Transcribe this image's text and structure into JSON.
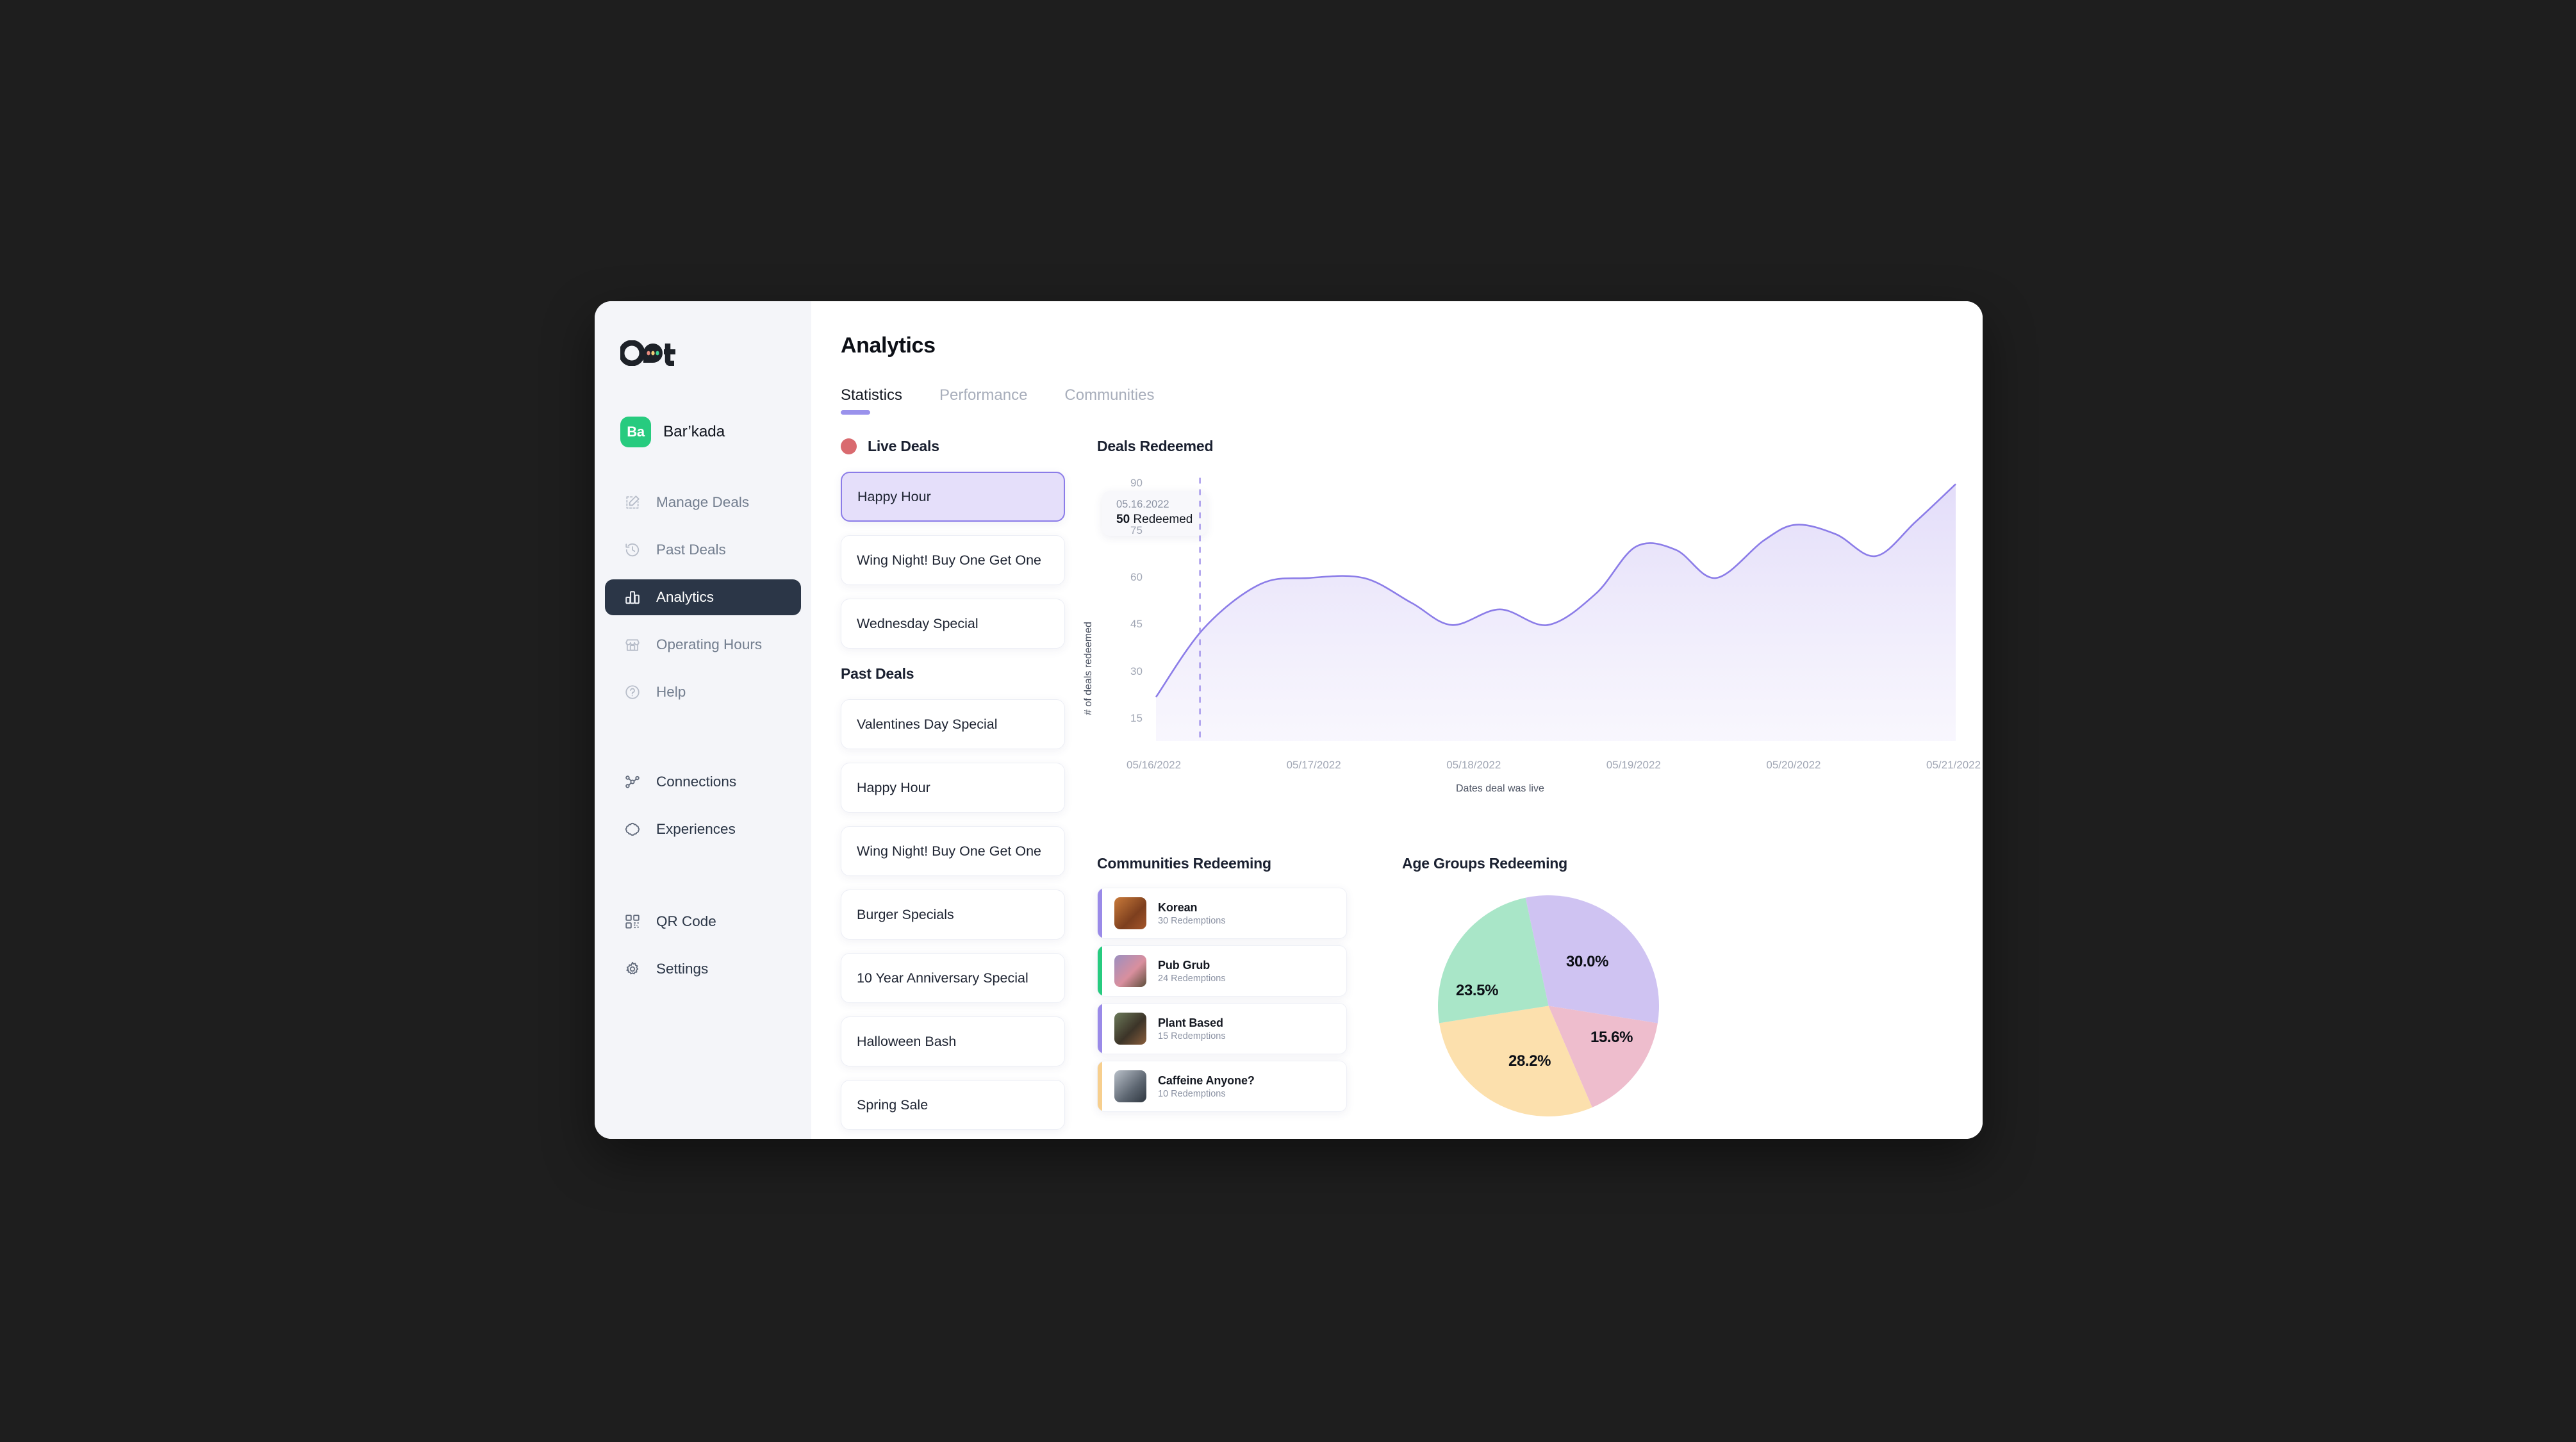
{
  "brand": {
    "logo_text": "Oot",
    "badge_initials": "Ba",
    "name": "Bar’kada"
  },
  "sidebar": {
    "items": [
      {
        "label": "Manage Deals",
        "icon": "edit-square-icon",
        "active": false
      },
      {
        "label": "Past Deals",
        "icon": "clock-rewind-icon",
        "active": false
      },
      {
        "label": "Analytics",
        "icon": "bar-chart-icon",
        "active": true
      },
      {
        "label": "Operating Hours",
        "icon": "storefront-icon",
        "active": false
      },
      {
        "label": "Help",
        "icon": "question-circle-icon",
        "active": false
      },
      {
        "label": "Connections",
        "icon": "network-nodes-icon",
        "active": false
      },
      {
        "label": "Experiences",
        "icon": "cloud-outline-icon",
        "active": false
      },
      {
        "label": "QR Code",
        "icon": "qr-code-icon",
        "active": false
      },
      {
        "label": "Settings",
        "icon": "gear-icon",
        "active": false
      }
    ]
  },
  "header": {
    "title": "Analytics",
    "tabs": [
      {
        "label": "Statistics",
        "active": true
      },
      {
        "label": "Performance",
        "active": false
      },
      {
        "label": "Communities",
        "active": false
      }
    ]
  },
  "deals": {
    "live_title": "Live Deals",
    "live": [
      {
        "label": "Happy Hour",
        "selected": true
      },
      {
        "label": "Wing Night! Buy One Get One",
        "selected": false
      },
      {
        "label": "Wednesday Special",
        "selected": false
      }
    ],
    "past_title": "Past Deals",
    "past": [
      {
        "label": "Valentines Day Special"
      },
      {
        "label": "Happy Hour"
      },
      {
        "label": "Wing Night! Buy One Get One"
      },
      {
        "label": "Burger Specials"
      },
      {
        "label": "10 Year Anniversary Special"
      },
      {
        "label": "Halloween Bash"
      },
      {
        "label": "Spring Sale"
      }
    ]
  },
  "tooltip": {
    "date": "05.16.2022",
    "value": "50",
    "suffix": " Redeemed"
  },
  "communities": {
    "title": "Communities Redeeming",
    "items": [
      {
        "name": "Korean",
        "redemptions": "30 Redemptions",
        "accent": "#9a8ae8",
        "thumb": "#b5622c"
      },
      {
        "name": "Pub Grub",
        "redemptions": "24 Redemptions",
        "accent": "#27cb7f",
        "thumb": "#8c7fa8"
      },
      {
        "name": "Plant Based",
        "redemptions": "15 Redemptions",
        "accent": "#9a8ae8",
        "thumb": "#4a5544"
      },
      {
        "name": "Caffeine Anyone?",
        "redemptions": "10 Redemptions",
        "accent": "#f7cf8e",
        "thumb": "#8d94a0"
      }
    ]
  },
  "chart_data": [
    {
      "type": "area",
      "title": "Deals Redeemed",
      "xlabel": "Dates deal was live",
      "ylabel": "# of deals redeemed",
      "x": [
        "05/16/2022",
        "05/17/2022",
        "05/18/2022",
        "05/19/2022",
        "05/20/2022",
        "05/21/2022"
      ],
      "yticks": [
        15,
        30,
        45,
        60,
        75,
        90
      ],
      "ylim": [
        8,
        96
      ],
      "grid": false,
      "line_color": "#8b7ce8",
      "fill_color": "#ece9fb",
      "marker_date": "05.16.2022",
      "marker_value": 50,
      "series": [
        {
          "name": "Deals Redeemed",
          "points": [
            {
              "t": 0.0,
              "v": 22
            },
            {
              "t": 0.06,
              "v": 44
            },
            {
              "t": 0.13,
              "v": 58
            },
            {
              "t": 0.19,
              "v": 60
            },
            {
              "t": 0.26,
              "v": 60
            },
            {
              "t": 0.32,
              "v": 52
            },
            {
              "t": 0.37,
              "v": 45
            },
            {
              "t": 0.43,
              "v": 50
            },
            {
              "t": 0.49,
              "v": 45
            },
            {
              "t": 0.55,
              "v": 55
            },
            {
              "t": 0.6,
              "v": 70
            },
            {
              "t": 0.65,
              "v": 69
            },
            {
              "t": 0.7,
              "v": 60
            },
            {
              "t": 0.76,
              "v": 72
            },
            {
              "t": 0.8,
              "v": 77
            },
            {
              "t": 0.85,
              "v": 74
            },
            {
              "t": 0.9,
              "v": 67
            },
            {
              "t": 0.95,
              "v": 78
            },
            {
              "t": 1.0,
              "v": 90
            }
          ]
        }
      ]
    },
    {
      "type": "pie",
      "title": "Age Groups Redeeming",
      "labels": [
        "30.0%",
        "15.6%",
        "28.2%",
        "23.5%"
      ],
      "values": [
        30.0,
        15.6,
        28.2,
        23.5
      ],
      "colors": [
        "#cfc3f2",
        "#eebdcd",
        "#fce0ad",
        "#a9e6c8"
      ],
      "start_angle": -12,
      "label_positions": [
        {
          "x": 200,
          "y": 90
        },
        {
          "x": 238,
          "y": 208
        },
        {
          "x": 110,
          "y": 245
        },
        {
          "x": 28,
          "y": 135
        }
      ]
    }
  ]
}
